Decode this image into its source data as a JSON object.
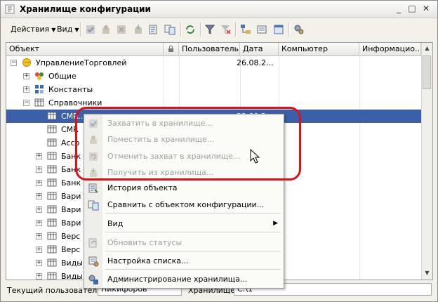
{
  "window": {
    "title": "Хранилище конфигурации"
  },
  "toolbar": {
    "actions_label": "Действия",
    "view_label": "Вид"
  },
  "grid": {
    "columns": [
      "Объект",
      "Пользователь",
      "Дата",
      "Компьютер",
      "Информацио..."
    ],
    "rows": [
      {
        "label": "УправлениеТорговлей",
        "date": "26.08.2..."
      },
      {
        "label": "Общие"
      },
      {
        "label": "Константы"
      },
      {
        "label": "Справочники"
      },
      {
        "label": "CMR...",
        "date": "22.09.2..."
      },
      {
        "label": "CMR"
      },
      {
        "label": "Ассо"
      },
      {
        "label": "Банк"
      },
      {
        "label": "Банк"
      },
      {
        "label": "Банк"
      },
      {
        "label": "Вари"
      },
      {
        "label": "Вари"
      },
      {
        "label": "Вари"
      },
      {
        "label": "Верс"
      },
      {
        "label": "Верс"
      },
      {
        "label": "Виды"
      },
      {
        "label": "Виды"
      }
    ]
  },
  "context_menu": {
    "items": [
      {
        "label": "Захватить в хранилище...",
        "icon": "lock-check-icon",
        "enabled": false
      },
      {
        "label": "Поместить в хранилище...",
        "icon": "put-icon",
        "enabled": false
      },
      {
        "label": "Отменить захват в хранилище...",
        "icon": "undo-lock-icon",
        "enabled": false
      },
      {
        "label": "Получить из хранилища...",
        "icon": "get-icon",
        "enabled": false
      },
      {
        "label": "История объекта",
        "icon": "history-icon",
        "enabled": true
      },
      {
        "label": "Сравнить с объектом конфигурации...",
        "icon": "compare-icon",
        "enabled": true
      },
      {
        "label": "Вид",
        "icon": "",
        "enabled": true,
        "submenu": true
      },
      {
        "label": "Обновить статусы",
        "icon": "refresh-icon",
        "enabled": false
      },
      {
        "label": "Настройка списка...",
        "icon": "list-settings-icon",
        "enabled": true
      },
      {
        "label": "Администрирование хранилища...",
        "icon": "admin-icon",
        "enabled": true
      }
    ]
  },
  "statusbar": {
    "user_label": "Текущий пользователь:",
    "user_value": "Никифоров",
    "storage_label": "Хранилище:",
    "storage_value": "C:\\1"
  },
  "colors": {
    "selection": "#3b5fa8",
    "highlight": "#e0101a"
  }
}
